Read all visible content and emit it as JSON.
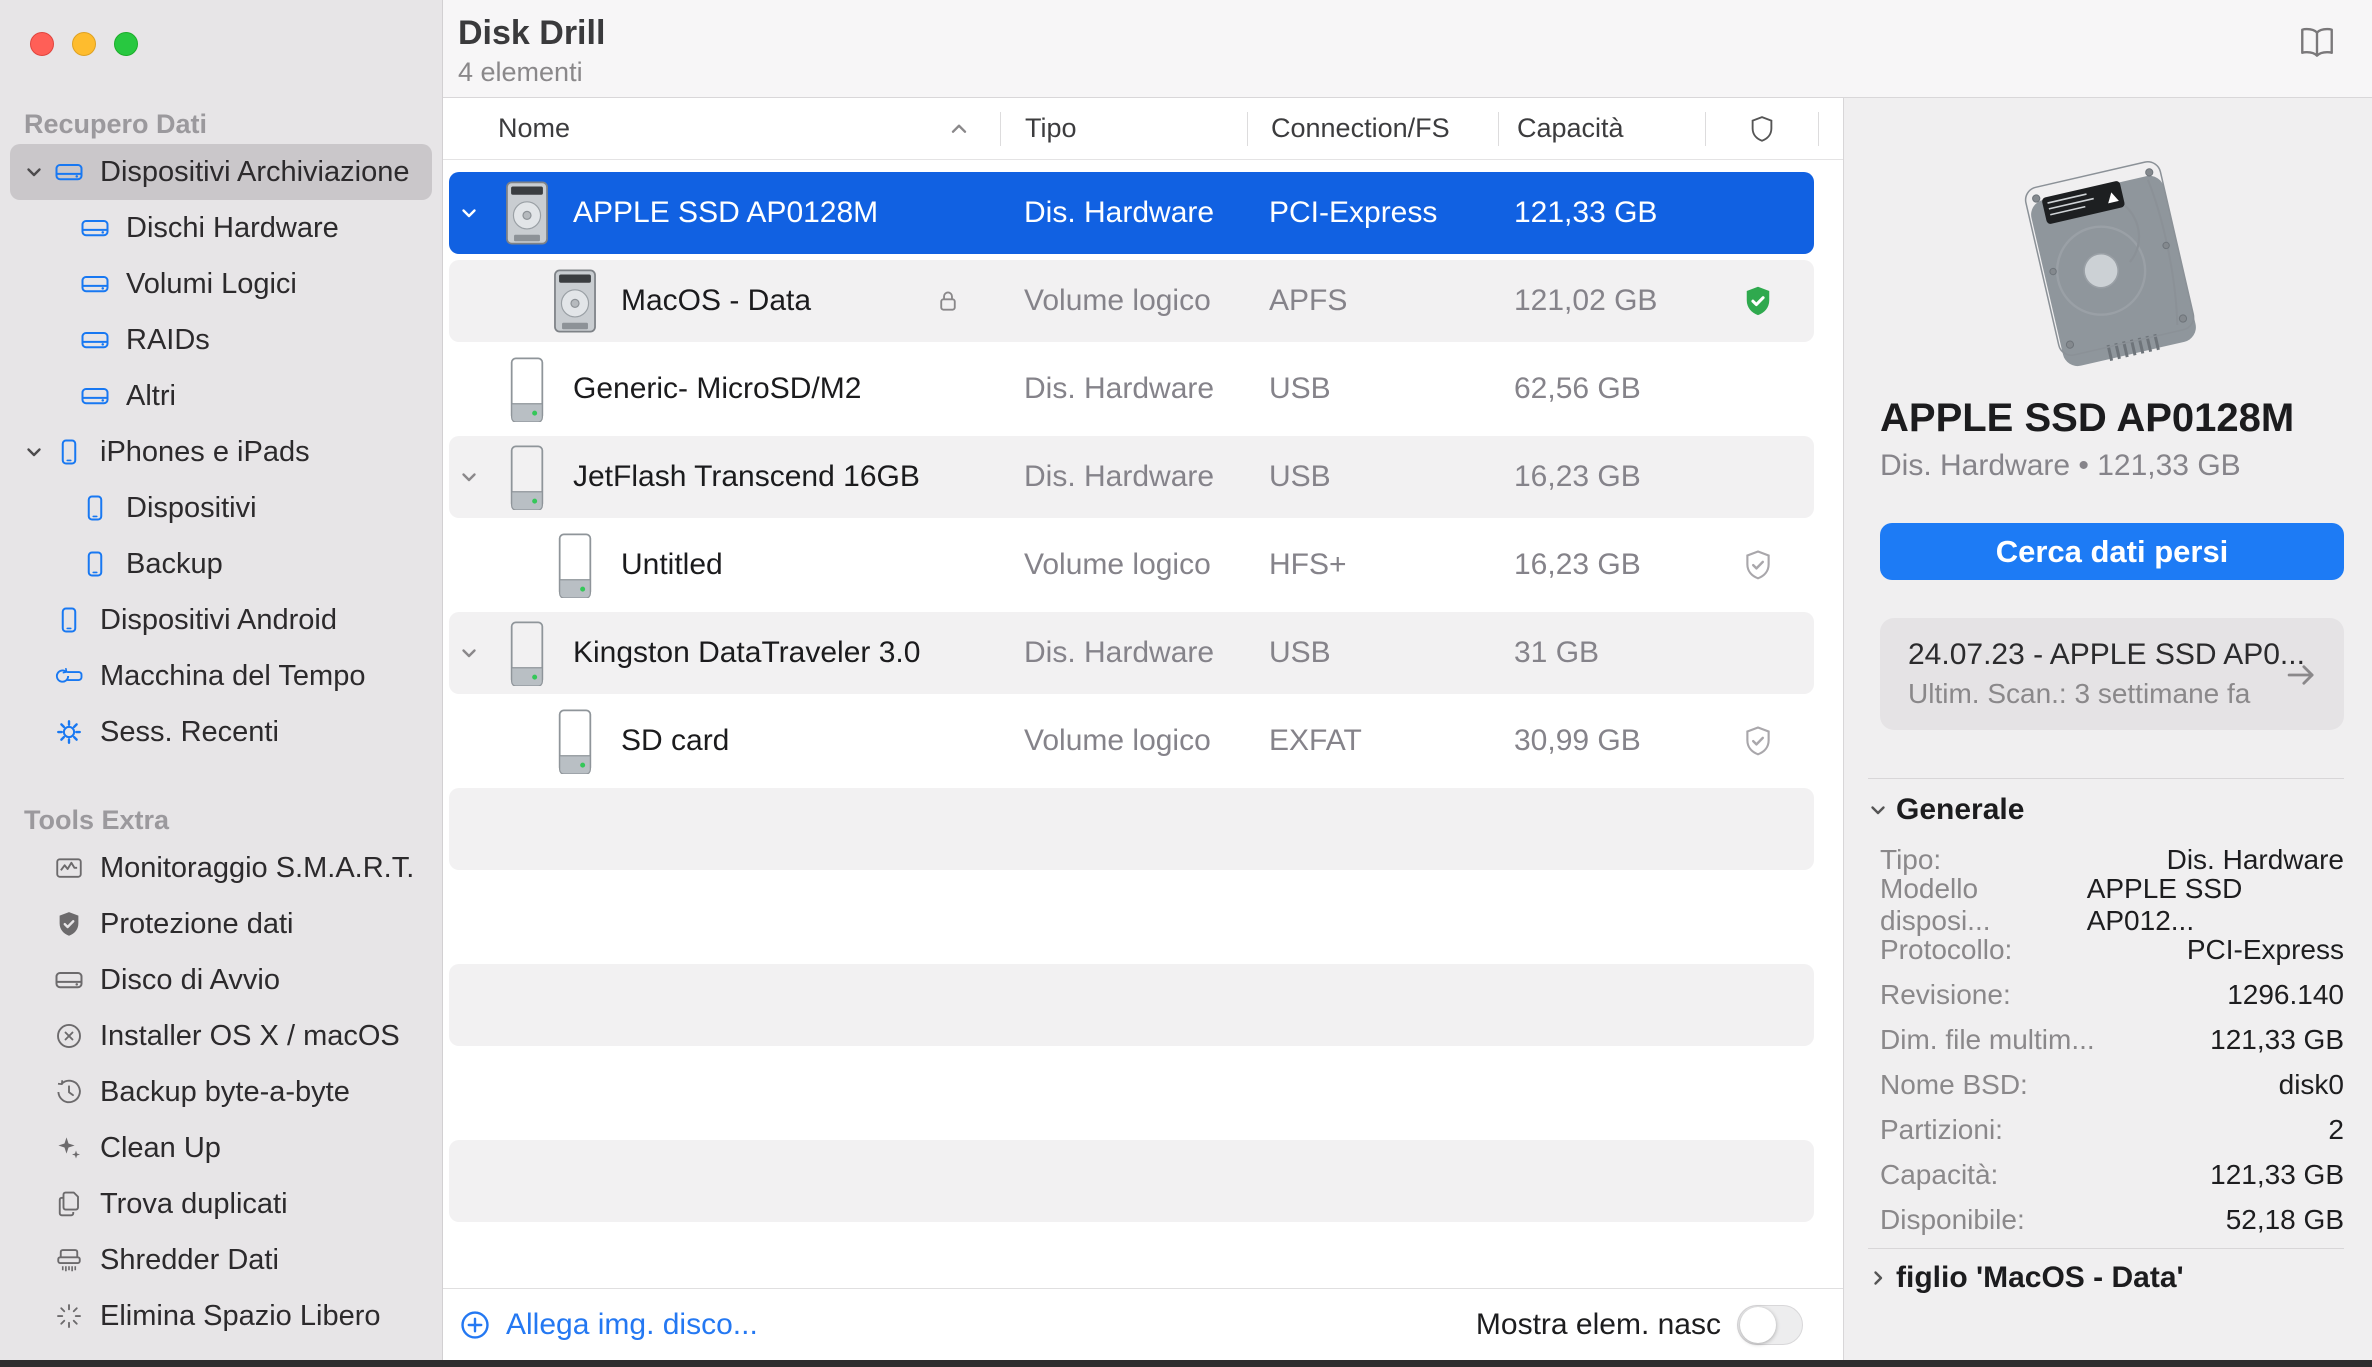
{
  "colors": {
    "selection_blue": "#1161e2",
    "button_blue": "#1d7bf5",
    "link_blue": "#2478f2",
    "sidebar_icon_blue": "#1878f2",
    "ok_green": "#2fa94e"
  },
  "window": {
    "title": "Disk Drill",
    "count": "4 elementi"
  },
  "icons": [
    "traffic-lights",
    "external-drive-icon",
    "iphone-icon",
    "time-machine-icon",
    "gear-icon",
    "smart-chart-icon",
    "shield-check-filled-icon",
    "circle-x-icon",
    "history-clock-icon",
    "sparkle-icon",
    "duplicate-docs-icon",
    "shredder-icon",
    "burst-icon",
    "book-icon",
    "sort-asc-icon",
    "shield-icon",
    "lock-icon",
    "chevron-down-icon",
    "chevron-right-icon",
    "circle-plus-icon",
    "arrow-right-icon",
    "hdd-icon",
    "usb-stick-icon"
  ],
  "sidebar": {
    "sections": [
      {
        "header": "Recupero Dati",
        "items": [
          {
            "label": "Dispositivi Archiviazione",
            "icon": "external-drive",
            "level": 0,
            "expanded": true,
            "selected": true
          },
          {
            "label": "Dischi Hardware",
            "icon": "external-drive",
            "level": 1
          },
          {
            "label": "Volumi Logici",
            "icon": "external-drive",
            "level": 1
          },
          {
            "label": "RAIDs",
            "icon": "external-drive",
            "level": 1
          },
          {
            "label": "Altri",
            "icon": "external-drive",
            "level": 1
          },
          {
            "label": "iPhones e iPads",
            "icon": "iphone",
            "level": 0,
            "expanded": true
          },
          {
            "label": "Dispositivi",
            "icon": "iphone",
            "level": 1
          },
          {
            "label": "Backup",
            "icon": "iphone",
            "level": 1
          },
          {
            "label": "Dispositivi Android",
            "icon": "iphone",
            "level": 0
          },
          {
            "label": "Macchina del Tempo",
            "icon": "time-machine",
            "level": 0
          },
          {
            "label": "Sess. Recenti",
            "icon": "gear",
            "level": 0
          }
        ]
      },
      {
        "header": "Tools Extra",
        "items": [
          {
            "label": "Monitoraggio S.M.A.R.T.",
            "icon": "smart-chart"
          },
          {
            "label": "Protezione dati",
            "icon": "shield-check-filled"
          },
          {
            "label": "Disco di Avvio",
            "icon": "external-drive"
          },
          {
            "label": "Installer OS X / macOS",
            "icon": "circle-x"
          },
          {
            "label": "Backup byte-a-byte",
            "icon": "history-clock"
          },
          {
            "label": "Clean Up",
            "icon": "sparkle"
          },
          {
            "label": "Trova duplicati",
            "icon": "duplicate-docs"
          },
          {
            "label": "Shredder Dati",
            "icon": "shredder"
          },
          {
            "label": "Elimina Spazio Libero",
            "icon": "burst"
          }
        ]
      }
    ]
  },
  "table": {
    "columns": {
      "name": "Nome",
      "type": "Tipo",
      "conn": "Connection/FS",
      "capacity": "Capacità"
    },
    "rows": [
      {
        "name": "APPLE SSD AP0128M",
        "type": "Dis. Hardware",
        "conn": "PCI-Express",
        "capacity": "121,33 GB",
        "icon": "hdd",
        "level": 0,
        "expanded": true,
        "selected": true
      },
      {
        "name": "MacOS - Data",
        "type": "Volume logico",
        "conn": "APFS",
        "capacity": "121,02 GB",
        "icon": "hdd",
        "level": 1,
        "locked": true,
        "shield": "green-check"
      },
      {
        "name": "Generic- MicroSD/M2",
        "type": "Dis. Hardware",
        "conn": "USB",
        "capacity": "62,56 GB",
        "icon": "usb",
        "level": 0
      },
      {
        "name": "JetFlash Transcend 16GB",
        "type": "Dis. Hardware",
        "conn": "USB",
        "capacity": "16,23 GB",
        "icon": "usb",
        "level": 0,
        "expanded": true
      },
      {
        "name": "Untitled",
        "type": "Volume logico",
        "conn": "HFS+",
        "capacity": "16,23 GB",
        "icon": "usb",
        "level": 1,
        "shield": "outline-check"
      },
      {
        "name": "Kingston DataTraveler 3.0",
        "type": "Dis. Hardware",
        "conn": "USB",
        "capacity": "31 GB",
        "icon": "usb",
        "level": 0,
        "expanded": true
      },
      {
        "name": "SD card",
        "type": "Volume logico",
        "conn": "EXFAT",
        "capacity": "30,99 GB",
        "icon": "usb",
        "level": 1,
        "shield": "outline-check"
      }
    ]
  },
  "footer": {
    "attach_link": "Allega img. disco...",
    "toggle_label": "Mostra elem. nasc",
    "toggle_on": false
  },
  "panel": {
    "title": "APPLE SSD AP0128M",
    "subtitle": "Dis. Hardware • 121,33 GB",
    "search_button": "Cerca dati persi",
    "scan_card": {
      "title": "24.07.23 - APPLE SSD AP0...",
      "subtitle": "Ultim. Scan.: 3 settimane fa"
    },
    "general": {
      "header": "Generale",
      "rows": [
        {
          "label": "Tipo:",
          "value": "Dis. Hardware"
        },
        {
          "label": "Modello disposi...",
          "value": "APPLE SSD AP012..."
        },
        {
          "label": "Protocollo:",
          "value": "PCI-Express"
        },
        {
          "label": "Revisione:",
          "value": "1296.140"
        },
        {
          "label": "Dim. file multim...",
          "value": "121,33 GB"
        },
        {
          "label": "Nome BSD:",
          "value": "disk0"
        },
        {
          "label": "Partizioni:",
          "value": "2"
        },
        {
          "label": "Capacità:",
          "value": "121,33 GB"
        },
        {
          "label": "Disponibile:",
          "value": "52,18 GB"
        }
      ]
    },
    "child_section": "figlio 'MacOS - Data'"
  }
}
